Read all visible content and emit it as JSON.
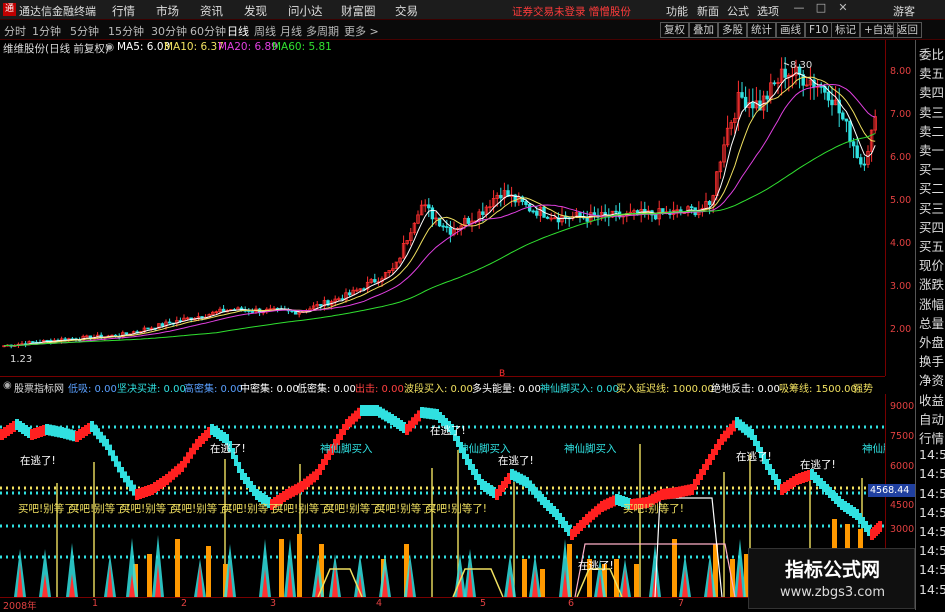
{
  "app": {
    "title": "通达信金融终端",
    "menus": [
      "行情",
      "市场",
      "资讯",
      "发现",
      "问小达",
      "财富圈",
      "交易"
    ],
    "notice": "证券交易未登录 憎憎股份",
    "right_menu": [
      "功能",
      "新面",
      "公式",
      "选项",
      "游客"
    ],
    "window_buttons": [
      "—",
      "□",
      "✕"
    ]
  },
  "toolbar": {
    "periods": [
      "分时",
      "1分钟",
      "5分钟",
      "15分钟",
      "30分钟",
      "60分钟",
      "日线",
      "周线",
      "月线",
      "多周期",
      "更多 >"
    ],
    "active_period": "日线",
    "right_buttons": [
      "复权",
      "叠加",
      "多股",
      "统计",
      "画线",
      "F10",
      "标记",
      "+自选",
      "返回"
    ]
  },
  "main_chart": {
    "stock_label": "维维股份(日线 前复权)",
    "ma": [
      {
        "label": "MA5: 6.03",
        "color": "#ffffff"
      },
      {
        "label": "MA10: 6.37",
        "color": "#f0e060"
      },
      {
        "label": "MA20: 6.89",
        "color": "#e040e0"
      },
      {
        "label": "MA60: 5.81",
        "color": "#30e030"
      }
    ],
    "y_ticks": [
      "8.00",
      "7.00",
      "6.00",
      "5.00",
      "4.00",
      "3.00",
      "2.00"
    ],
    "high_label": "8.30",
    "low_label": "1.23",
    "marker": "B"
  },
  "indicator": {
    "name": "股票指标网",
    "items": [
      {
        "text": "低吸: 0.00",
        "color": "#5aa0ff"
      },
      {
        "text": "坚决买进: 0.00",
        "color": "#30e0e0"
      },
      {
        "text": "高密集: 0.00",
        "color": "#5aa0ff"
      },
      {
        "text": "中密集: 0.00",
        "color": "#ffffff"
      },
      {
        "text": "低密集: 0.00",
        "color": "#ffffff"
      },
      {
        "text": "出击: 0.00",
        "color": "#ff4040"
      },
      {
        "text": "波段买入: 0.00",
        "color": "#f0e060"
      },
      {
        "text": "多头能量: 0.00",
        "color": "#ffffff"
      },
      {
        "text": "神仙脚买入: 0.00",
        "color": "#30e0e0"
      },
      {
        "text": "买入延迟线: 1000.00",
        "color": "#f0e060"
      },
      {
        "text": "绝地反击: 0.00",
        "color": "#ffffff"
      },
      {
        "text": "吸筹线: 1500.00",
        "color": "#f0e060"
      },
      {
        "text": "强势",
        "color": "#f0e060"
      }
    ],
    "y_ticks": [
      "9000",
      "7500",
      "6000",
      "4500",
      "3000"
    ],
    "value_box": "4568.44",
    "labels": {
      "escape": "在逃了!",
      "shenxian": "神仙脚买入",
      "buy": "买吧!别等了!"
    }
  },
  "x_axis": [
    "2008年",
    "1",
    "2",
    "3",
    "4",
    "5",
    "6",
    "7"
  ],
  "sidebar": [
    "委比",
    "卖五",
    "卖四",
    "卖三",
    "卖二",
    "卖一",
    "买一",
    "买二",
    "买三",
    "买四",
    "买五",
    "现价",
    "涨跌",
    "涨幅",
    "总量",
    "外盘",
    "换手",
    "净资",
    "收益",
    "自动",
    "行情",
    "14:5",
    "14:5",
    "14:5",
    "14:5",
    "14:5",
    "14:5",
    "14:5",
    "14:5"
  ],
  "watermark": {
    "title": "指标公式网",
    "url": "www.zbgs3.com"
  }
}
